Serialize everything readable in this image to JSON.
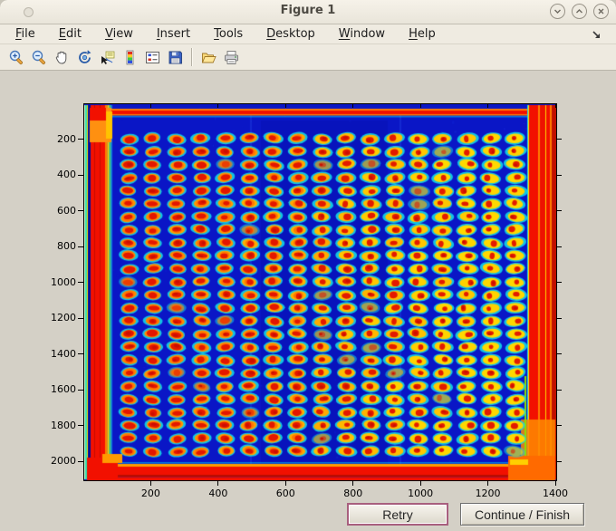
{
  "window": {
    "title": "Figure 1",
    "controls": [
      {
        "name": "shade-button",
        "glyph": "chevron-down"
      },
      {
        "name": "maximize-button",
        "glyph": "chevron-up"
      },
      {
        "name": "close-button",
        "glyph": "x"
      }
    ]
  },
  "menu": {
    "items": [
      {
        "label": "File",
        "mnemonic": "F"
      },
      {
        "label": "Edit",
        "mnemonic": "E"
      },
      {
        "label": "View",
        "mnemonic": "V"
      },
      {
        "label": "Insert",
        "mnemonic": "I"
      },
      {
        "label": "Tools",
        "mnemonic": "T"
      },
      {
        "label": "Desktop",
        "mnemonic": "D"
      },
      {
        "label": "Window",
        "mnemonic": "W"
      },
      {
        "label": "Help",
        "mnemonic": "H"
      }
    ],
    "dock_icon": "dock-arrow-icon"
  },
  "toolbar": {
    "icons": [
      "zoom-in-icon",
      "zoom-out-icon",
      "pan-icon",
      "rotate-3d-icon",
      "data-cursor-icon",
      "colorbar-icon",
      "legend-icon",
      "save-icon",
      "separator",
      "open-folder-icon",
      "print-icon"
    ]
  },
  "buttons": {
    "retry_label": "Retry",
    "continue_label": "Continue / Finish"
  },
  "chart_data": {
    "type": "heatmap",
    "title": "",
    "xlabel": "",
    "ylabel": "",
    "xlim": [
      0,
      1400
    ],
    "ylim": [
      0,
      2100
    ],
    "y_axis_reversed": true,
    "x_ticks": [
      200,
      400,
      600,
      800,
      1000,
      1200,
      1400
    ],
    "y_ticks": [
      200,
      400,
      600,
      800,
      1000,
      1200,
      1400,
      1600,
      1800,
      2000
    ],
    "grid": false,
    "colormap": "jet",
    "description": "False-color (jet colormap) scan of a microarray slide: regular grid of hybridization spots with red cores, orange-yellow rings and cyan halos on a dark blue background; saturated red/orange scan-edge bands along all four borders.",
    "spot_grid": {
      "rows": 25,
      "cols": 17,
      "x_first": 132,
      "x_last": 1279,
      "y_first": 192,
      "y_last": 1938
    },
    "colors": {
      "background_blue": "#0a16c6",
      "halo_cyan": "#12dce8",
      "ring_yellow": "#ffd800",
      "ring_orange": "#ff8a00",
      "core_red": "#e21300",
      "border_red": "#f21000",
      "border_dark_red": "#c50c00",
      "border_orange": "#ff7e00",
      "border_yellow": "#ffd800",
      "border_green": "#42e080",
      "border_inner_blue": "#000e9e"
    }
  }
}
